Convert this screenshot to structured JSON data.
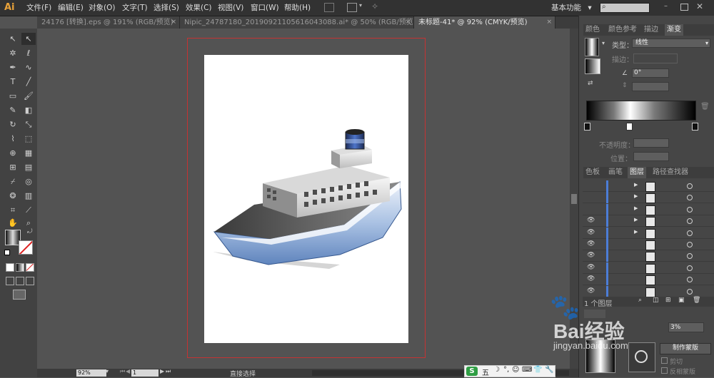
{
  "app": {
    "logo": "Ai"
  },
  "menu": [
    "文件(F)",
    "编辑(E)",
    "对象(O)",
    "文字(T)",
    "选择(S)",
    "效果(C)",
    "视图(V)",
    "窗口(W)",
    "帮助(H)"
  ],
  "workspace": {
    "label": "基本功能",
    "arrow": "▾"
  },
  "tabs": [
    {
      "label": "24176 [转换].eps @ 191% (RGB/预览)"
    },
    {
      "label": "Nipic_24787180_20190921105616043088.ai* @ 50% (RGB/预览)"
    },
    {
      "label": "未标题-41* @ 92% (CMYK/预览)"
    }
  ],
  "tab_close": "×",
  "gradient_panel": {
    "tabs": [
      "颜色",
      "颜色参考",
      "描边",
      "渐变"
    ],
    "type_label": "类型：",
    "type_value": "线性",
    "stroke_label": "描边：",
    "angle_value": "0°",
    "opacity_label": "不透明度：",
    "position_label": "位置："
  },
  "layers_panel": {
    "tabs": [
      "色板",
      "画笔",
      "图层",
      "路径查找器"
    ],
    "footer_label": "1 个图层",
    "rows": [
      {
        "visible": false,
        "expand": true
      },
      {
        "visible": false,
        "expand": true
      },
      {
        "visible": false,
        "expand": true
      },
      {
        "visible": true,
        "expand": true
      },
      {
        "visible": true,
        "expand": true
      },
      {
        "visible": true,
        "expand": false
      },
      {
        "visible": true,
        "expand": false
      },
      {
        "visible": true,
        "expand": false
      },
      {
        "visible": true,
        "expand": false
      },
      {
        "visible": true,
        "expand": false
      }
    ]
  },
  "transparency_panel": {
    "percent": "3%",
    "make_mask": "制作蒙版",
    "clip": "剪切",
    "invert": "反相蒙版"
  },
  "status": {
    "zoom": "92%",
    "page": "1",
    "tool": "直接选择"
  },
  "watermark": {
    "text": "Bai经验",
    "sub": "jingyan.baidu.com"
  },
  "ime": {
    "label": "五"
  },
  "colors": {
    "accent": "#4c7dd6",
    "bleed": "#c43333",
    "brand": "#e8a23a",
    "ime_green": "#2f9e44"
  }
}
